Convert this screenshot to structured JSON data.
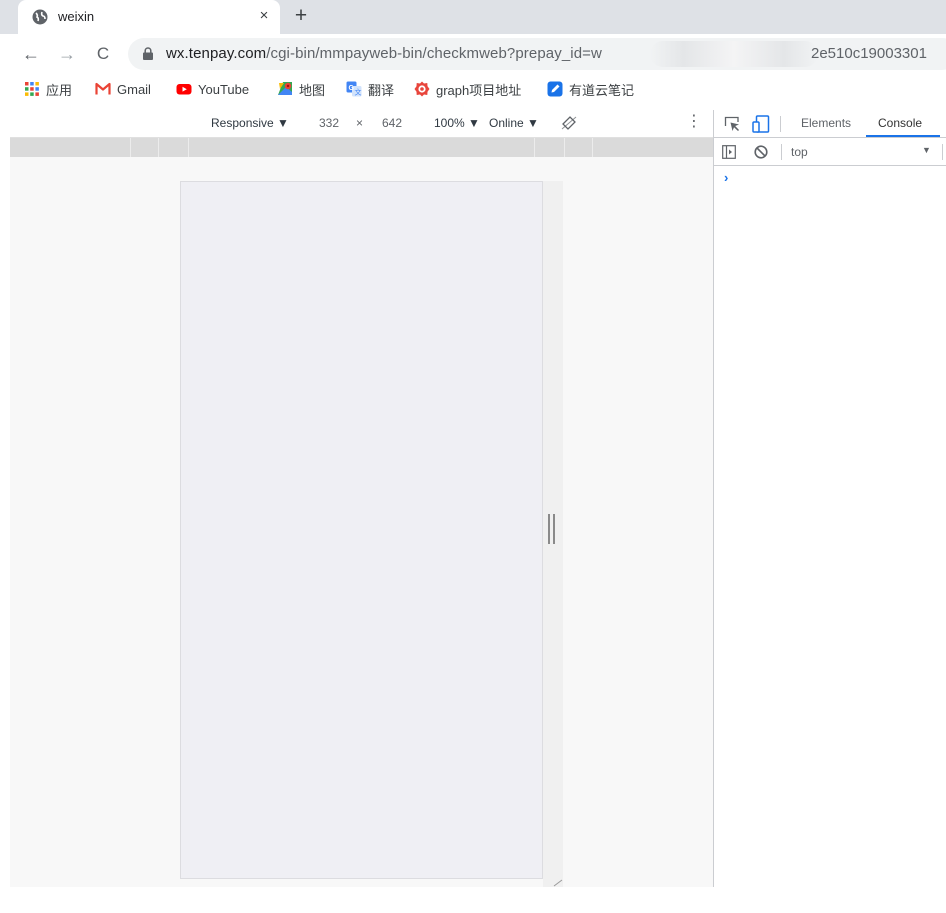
{
  "tab": {
    "title": "weixin",
    "close": "×",
    "new_tab": "+"
  },
  "nav": {
    "back": "←",
    "forward": "→",
    "reload": "C"
  },
  "address": {
    "host": "wx.tenpay.com",
    "path": "/cgi-bin/mmpayweb-bin/checkmweb?prepay_id=w",
    "tail": "2e510c19003301"
  },
  "bookmarks": [
    {
      "label": "应用",
      "icon": "apps-grid-icon"
    },
    {
      "label": "Gmail",
      "icon": "gmail-icon"
    },
    {
      "label": "YouTube",
      "icon": "youtube-icon"
    },
    {
      "label": "地图",
      "icon": "maps-icon"
    },
    {
      "label": "翻译",
      "icon": "translate-icon"
    },
    {
      "label": "graph项目地址",
      "icon": "graph-icon"
    },
    {
      "label": "有道云笔记",
      "icon": "youdao-note-icon"
    }
  ],
  "device_toolbar": {
    "device": "Responsive ▼",
    "width": "332",
    "times": "×",
    "height": "642",
    "zoom": "100% ▼",
    "network": "Online ▼",
    "more": "⋮"
  },
  "devtools": {
    "tabs": [
      "Elements",
      "Console"
    ],
    "active_tab": "Console",
    "context": "top",
    "context_arrow": "▼",
    "prompt": "›"
  },
  "colors": {
    "accent": "#1a73e8",
    "tabstrip": "#dee1e6",
    "device_bg": "#efeff4"
  }
}
